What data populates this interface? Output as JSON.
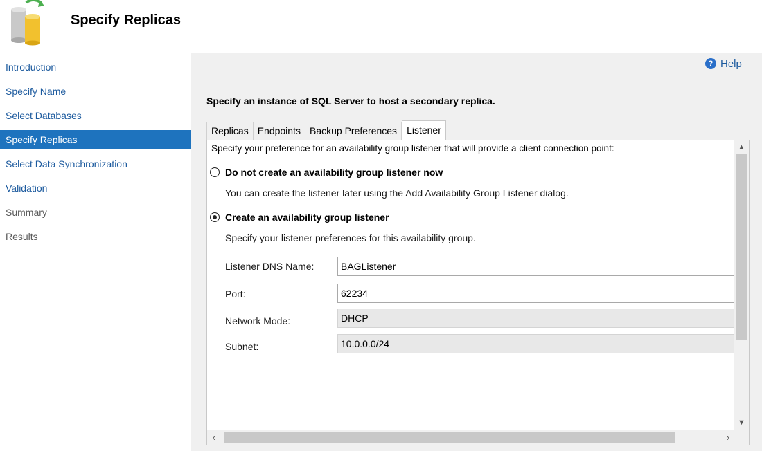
{
  "header": {
    "title": "Specify Replicas",
    "icon": "database-replica-icon"
  },
  "sidebar": {
    "items": [
      {
        "label": "Introduction",
        "state": "link"
      },
      {
        "label": "Specify Name",
        "state": "link"
      },
      {
        "label": "Select Databases",
        "state": "link"
      },
      {
        "label": "Specify Replicas",
        "state": "active"
      },
      {
        "label": "Select Data Synchronization",
        "state": "link"
      },
      {
        "label": "Validation",
        "state": "link"
      },
      {
        "label": "Summary",
        "state": "disabled"
      },
      {
        "label": "Results",
        "state": "disabled"
      }
    ]
  },
  "main": {
    "help_label": "Help",
    "instruction": "Specify an instance of SQL Server to host a secondary replica.",
    "tabs": [
      {
        "label": "Replicas",
        "active": false
      },
      {
        "label": "Endpoints",
        "active": false
      },
      {
        "label": "Backup Preferences",
        "active": false
      },
      {
        "label": "Listener",
        "active": true
      }
    ],
    "listener": {
      "intro": "Specify your preference for an availability group listener that will provide a client connection point:",
      "option_none": {
        "label": "Do not create an availability group listener now",
        "description": "You can create the listener later using the Add Availability Group Listener dialog.",
        "selected": false
      },
      "option_create": {
        "label": "Create an availability group listener",
        "description": "Specify your listener preferences for this availability group.",
        "selected": true
      },
      "fields": {
        "dns_name": {
          "label": "Listener DNS Name:",
          "value": "BAGListener"
        },
        "port": {
          "label": "Port:",
          "value": "62234"
        },
        "network_mode": {
          "label": "Network Mode:",
          "value": "DHCP"
        },
        "subnet": {
          "label": "Subnet:",
          "value": "10.0.0.0/24"
        }
      }
    }
  },
  "colors": {
    "accent": "#1e73be",
    "link": "#1c5a9e",
    "sidebar_bg": "#ffffff",
    "content_bg": "#f0f0f0"
  }
}
